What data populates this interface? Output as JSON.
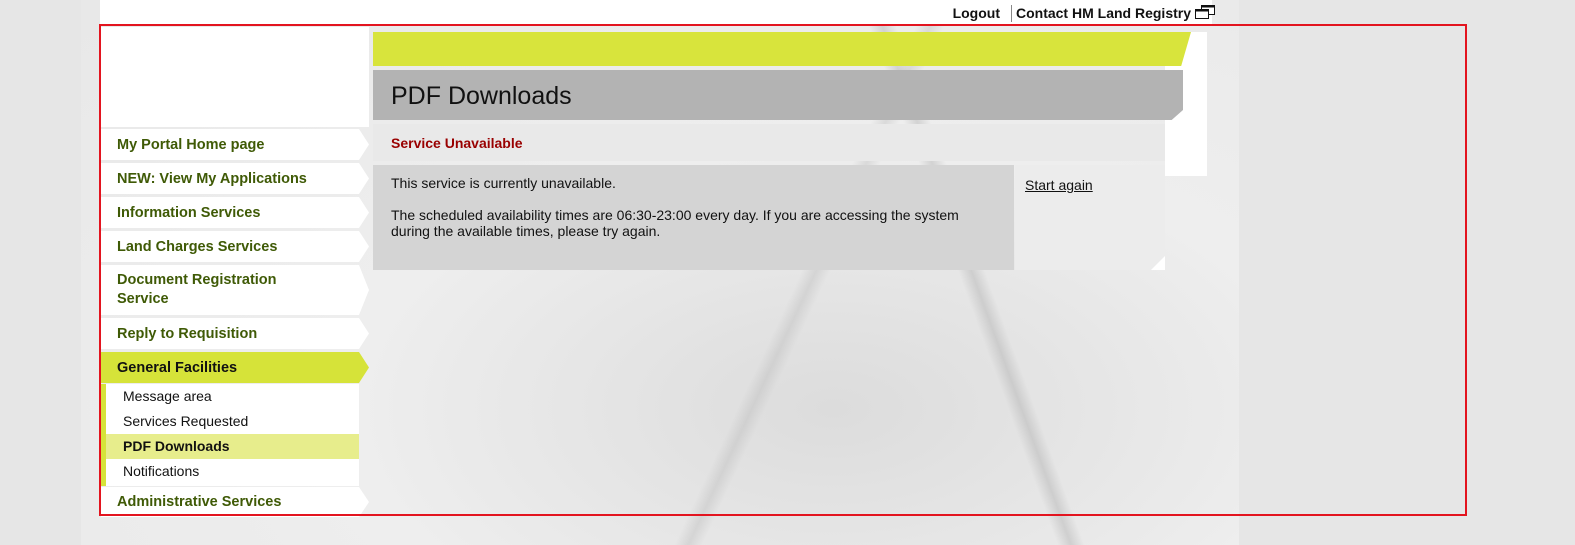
{
  "header": {
    "logout_label": "Logout",
    "contact_label": "Contact HM Land Registry"
  },
  "sidebar": {
    "items": [
      {
        "label": "My Portal Home page"
      },
      {
        "label": "NEW: View My Applications"
      },
      {
        "label": "Information Services"
      },
      {
        "label": "Land Charges Services"
      },
      {
        "label": "Document Registration Service"
      },
      {
        "label": "Reply to Requisition"
      },
      {
        "label": "General Facilities"
      },
      {
        "label": "Administrative Services"
      }
    ],
    "active_item": "General Facilities",
    "submenu": [
      {
        "label": "Message area"
      },
      {
        "label": "Services Requested"
      },
      {
        "label": "PDF Downloads"
      },
      {
        "label": "Notifications"
      }
    ],
    "active_subitem": "PDF Downloads"
  },
  "main": {
    "page_title": "PDF Downloads",
    "service_title": "Service Unavailable",
    "message_line1": "This service is currently unavailable.",
    "message_line2": "The scheduled availability times are 06:30-23:00 every day. If you are accessing the system during the available times, please try again.",
    "start_again_label": "Start again"
  },
  "colors": {
    "accent_green": "#d6e339",
    "nav_text": "#3f5a06",
    "error_red": "#990000",
    "outline_red": "#e3141f"
  },
  "icons": {
    "contact": "external-window-icon"
  }
}
